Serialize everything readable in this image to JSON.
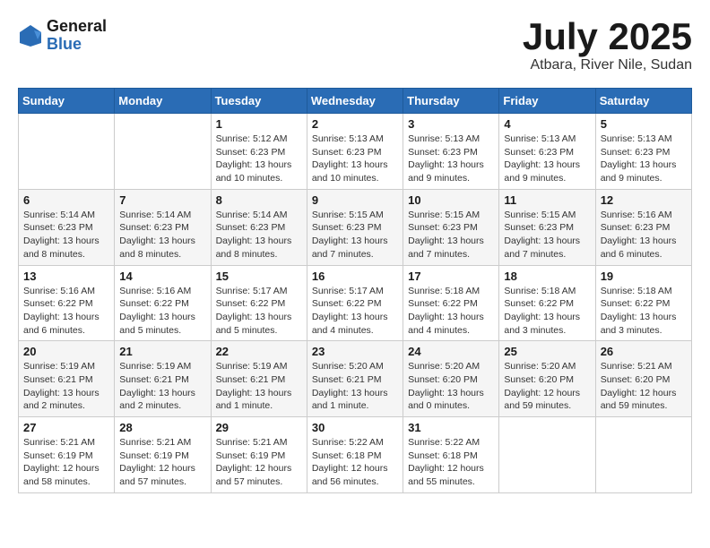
{
  "logo": {
    "general": "General",
    "blue": "Blue"
  },
  "title": "July 2025",
  "location": "Atbara, River Nile, Sudan",
  "days_of_week": [
    "Sunday",
    "Monday",
    "Tuesday",
    "Wednesday",
    "Thursday",
    "Friday",
    "Saturday"
  ],
  "weeks": [
    [
      {
        "day": "",
        "info": ""
      },
      {
        "day": "",
        "info": ""
      },
      {
        "day": "1",
        "info": "Sunrise: 5:12 AM\nSunset: 6:23 PM\nDaylight: 13 hours\nand 10 minutes."
      },
      {
        "day": "2",
        "info": "Sunrise: 5:13 AM\nSunset: 6:23 PM\nDaylight: 13 hours\nand 10 minutes."
      },
      {
        "day": "3",
        "info": "Sunrise: 5:13 AM\nSunset: 6:23 PM\nDaylight: 13 hours\nand 9 minutes."
      },
      {
        "day": "4",
        "info": "Sunrise: 5:13 AM\nSunset: 6:23 PM\nDaylight: 13 hours\nand 9 minutes."
      },
      {
        "day": "5",
        "info": "Sunrise: 5:13 AM\nSunset: 6:23 PM\nDaylight: 13 hours\nand 9 minutes."
      }
    ],
    [
      {
        "day": "6",
        "info": "Sunrise: 5:14 AM\nSunset: 6:23 PM\nDaylight: 13 hours\nand 8 minutes."
      },
      {
        "day": "7",
        "info": "Sunrise: 5:14 AM\nSunset: 6:23 PM\nDaylight: 13 hours\nand 8 minutes."
      },
      {
        "day": "8",
        "info": "Sunrise: 5:14 AM\nSunset: 6:23 PM\nDaylight: 13 hours\nand 8 minutes."
      },
      {
        "day": "9",
        "info": "Sunrise: 5:15 AM\nSunset: 6:23 PM\nDaylight: 13 hours\nand 7 minutes."
      },
      {
        "day": "10",
        "info": "Sunrise: 5:15 AM\nSunset: 6:23 PM\nDaylight: 13 hours\nand 7 minutes."
      },
      {
        "day": "11",
        "info": "Sunrise: 5:15 AM\nSunset: 6:23 PM\nDaylight: 13 hours\nand 7 minutes."
      },
      {
        "day": "12",
        "info": "Sunrise: 5:16 AM\nSunset: 6:23 PM\nDaylight: 13 hours\nand 6 minutes."
      }
    ],
    [
      {
        "day": "13",
        "info": "Sunrise: 5:16 AM\nSunset: 6:22 PM\nDaylight: 13 hours\nand 6 minutes."
      },
      {
        "day": "14",
        "info": "Sunrise: 5:16 AM\nSunset: 6:22 PM\nDaylight: 13 hours\nand 5 minutes."
      },
      {
        "day": "15",
        "info": "Sunrise: 5:17 AM\nSunset: 6:22 PM\nDaylight: 13 hours\nand 5 minutes."
      },
      {
        "day": "16",
        "info": "Sunrise: 5:17 AM\nSunset: 6:22 PM\nDaylight: 13 hours\nand 4 minutes."
      },
      {
        "day": "17",
        "info": "Sunrise: 5:18 AM\nSunset: 6:22 PM\nDaylight: 13 hours\nand 4 minutes."
      },
      {
        "day": "18",
        "info": "Sunrise: 5:18 AM\nSunset: 6:22 PM\nDaylight: 13 hours\nand 3 minutes."
      },
      {
        "day": "19",
        "info": "Sunrise: 5:18 AM\nSunset: 6:22 PM\nDaylight: 13 hours\nand 3 minutes."
      }
    ],
    [
      {
        "day": "20",
        "info": "Sunrise: 5:19 AM\nSunset: 6:21 PM\nDaylight: 13 hours\nand 2 minutes."
      },
      {
        "day": "21",
        "info": "Sunrise: 5:19 AM\nSunset: 6:21 PM\nDaylight: 13 hours\nand 2 minutes."
      },
      {
        "day": "22",
        "info": "Sunrise: 5:19 AM\nSunset: 6:21 PM\nDaylight: 13 hours\nand 1 minute."
      },
      {
        "day": "23",
        "info": "Sunrise: 5:20 AM\nSunset: 6:21 PM\nDaylight: 13 hours\nand 1 minute."
      },
      {
        "day": "24",
        "info": "Sunrise: 5:20 AM\nSunset: 6:20 PM\nDaylight: 13 hours\nand 0 minutes."
      },
      {
        "day": "25",
        "info": "Sunrise: 5:20 AM\nSunset: 6:20 PM\nDaylight: 12 hours\nand 59 minutes."
      },
      {
        "day": "26",
        "info": "Sunrise: 5:21 AM\nSunset: 6:20 PM\nDaylight: 12 hours\nand 59 minutes."
      }
    ],
    [
      {
        "day": "27",
        "info": "Sunrise: 5:21 AM\nSunset: 6:19 PM\nDaylight: 12 hours\nand 58 minutes."
      },
      {
        "day": "28",
        "info": "Sunrise: 5:21 AM\nSunset: 6:19 PM\nDaylight: 12 hours\nand 57 minutes."
      },
      {
        "day": "29",
        "info": "Sunrise: 5:21 AM\nSunset: 6:19 PM\nDaylight: 12 hours\nand 57 minutes."
      },
      {
        "day": "30",
        "info": "Sunrise: 5:22 AM\nSunset: 6:18 PM\nDaylight: 12 hours\nand 56 minutes."
      },
      {
        "day": "31",
        "info": "Sunrise: 5:22 AM\nSunset: 6:18 PM\nDaylight: 12 hours\nand 55 minutes."
      },
      {
        "day": "",
        "info": ""
      },
      {
        "day": "",
        "info": ""
      }
    ]
  ]
}
